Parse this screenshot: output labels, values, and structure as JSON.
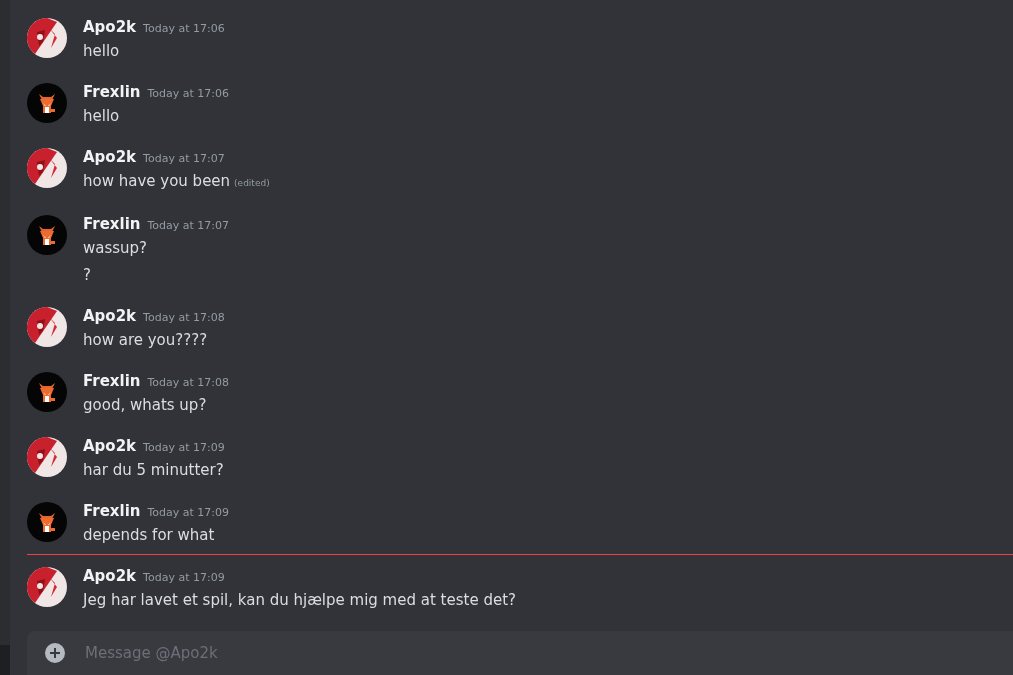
{
  "messages": [
    {
      "author": "Apo2k",
      "kind": "apo",
      "time": "Today at 17:06",
      "new_divider": false,
      "lines": [
        {
          "text": "hello"
        }
      ]
    },
    {
      "author": "Frexlin",
      "kind": "fox",
      "time": "Today at 17:06",
      "new_divider": false,
      "lines": [
        {
          "text": "hello"
        }
      ]
    },
    {
      "author": "Apo2k",
      "kind": "apo",
      "time": "Today at 17:07",
      "new_divider": false,
      "lines": [
        {
          "text": "how have you been",
          "edited": "(edited)"
        }
      ]
    },
    {
      "author": "Frexlin",
      "kind": "fox",
      "time": "Today at 17:07",
      "new_divider": false,
      "lines": [
        {
          "text": "wassup?"
        },
        {
          "text": "?"
        }
      ]
    },
    {
      "author": "Apo2k",
      "kind": "apo",
      "time": "Today at 17:08",
      "new_divider": false,
      "lines": [
        {
          "text": "how are you????"
        }
      ]
    },
    {
      "author": "Frexlin",
      "kind": "fox",
      "time": "Today at 17:08",
      "new_divider": false,
      "lines": [
        {
          "text": "good, whats up?"
        }
      ]
    },
    {
      "author": "Apo2k",
      "kind": "apo",
      "time": "Today at 17:09",
      "new_divider": false,
      "lines": [
        {
          "text": "har du 5 minutter?"
        }
      ]
    },
    {
      "author": "Frexlin",
      "kind": "fox",
      "time": "Today at 17:09",
      "new_divider": false,
      "lines": [
        {
          "text": "depends for what"
        }
      ]
    },
    {
      "author": "Apo2k",
      "kind": "apo",
      "time": "Today at 17:09",
      "new_divider": true,
      "lines": [
        {
          "text": "Jeg har lavet et spil, kan du hjælpe mig med at teste det?"
        }
      ]
    }
  ],
  "composer": {
    "placeholder": "Message @Apo2k"
  }
}
